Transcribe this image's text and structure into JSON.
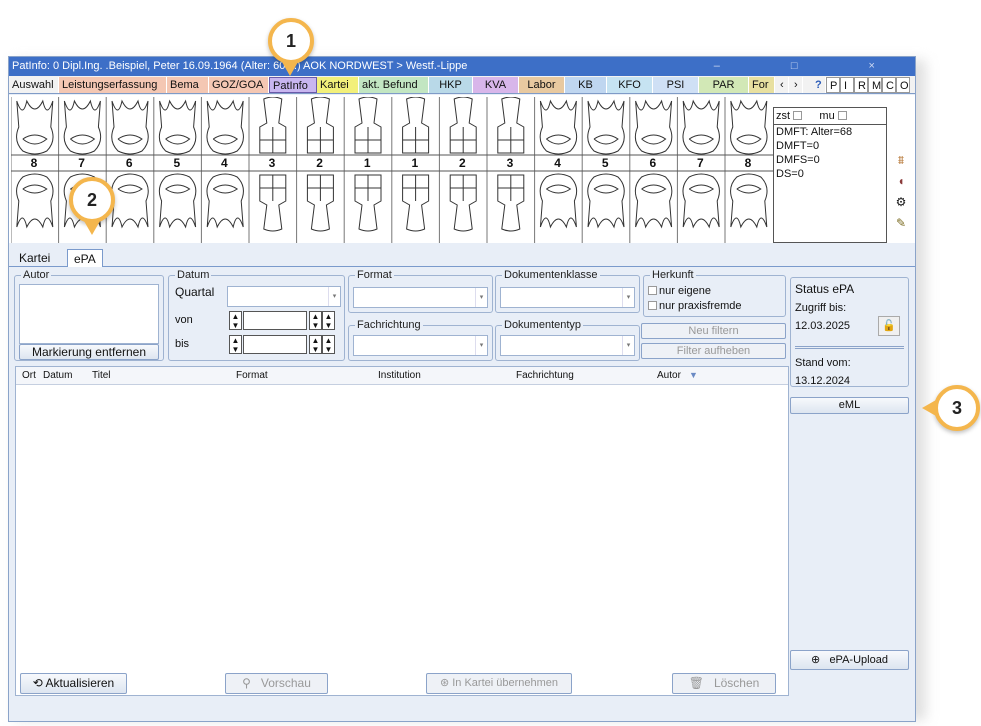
{
  "window": {
    "title": "PatInfo: 0  Dipl.Ing. .Beispiel, Peter  16.09.1964 (Alter: 60 J.)  AOK NORDWEST > Westf.-Lippe",
    "controls": "–  □  ×"
  },
  "nav_tabs": [
    {
      "label": "Auswahl",
      "color": "#f2f2f2"
    },
    {
      "label": "Leistungserfassung",
      "color": "#f4c7b3"
    },
    {
      "label": "Bema",
      "color": "#f4c7b3"
    },
    {
      "label": "GOZ/GOA",
      "color": "#f4c7b3"
    },
    {
      "label": "PatInfo",
      "color": "#c8b6f0"
    },
    {
      "label": "Kartei",
      "color": "#f2f07a"
    },
    {
      "label": "akt. Befund",
      "color": "#c2e6c2"
    },
    {
      "label": "HKP",
      "color": "#b9d9e8"
    },
    {
      "label": "KVA",
      "color": "#d8b6ea"
    },
    {
      "label": "Labor",
      "color": "#e8c9a0"
    },
    {
      "label": "KB",
      "color": "#bfd6f0"
    },
    {
      "label": "KFO",
      "color": "#c6e3f2"
    },
    {
      "label": "PSI",
      "color": "#cfe0f5"
    },
    {
      "label": "PAR",
      "color": "#d2e8b6"
    },
    {
      "label": "For",
      "color": "#e8e0a0"
    }
  ],
  "tab_arrows": [
    "‹",
    "›"
  ],
  "quick_letters": [
    "P",
    "I",
    "R",
    "M",
    "C",
    "O"
  ],
  "tooth_numbers": [
    "8",
    "7",
    "6",
    "5",
    "4",
    "3",
    "2",
    "1",
    "1",
    "2",
    "3",
    "4",
    "5",
    "6",
    "7",
    "8"
  ],
  "info_box": {
    "zst": "zst",
    "mu": "mu",
    "lines": [
      "DMFT: Alter=68",
      "DMFT=0",
      "DMFS=0",
      "DS=0"
    ]
  },
  "subtabs": {
    "kartei": "Kartei",
    "epa": "ePA"
  },
  "filters": {
    "autor": "Autor",
    "markierung": "Markierung entfernen",
    "datum": "Datum",
    "quartal": "Quartal",
    "von": "von",
    "bis": "bis",
    "format": "Format",
    "fachrichtung": "Fachrichtung",
    "dokumentenklasse": "Dokumentenklasse",
    "dokumententyp": "Dokumententyp",
    "herkunft": "Herkunft",
    "nur_eigene": "nur eigene",
    "nur_praxisfremde": "nur praxisfremde",
    "neu_filtern": "Neu filtern",
    "filter_aufheben": "Filter aufheben"
  },
  "status_epa": {
    "title": "Status ePA",
    "zugriff_label": "Zugriff bis:",
    "zugriff_date": "12.03.2025",
    "stand_label": "Stand vom:",
    "stand_date": "13.12.2024"
  },
  "columns": [
    "Ort",
    "Datum",
    "Titel",
    "Format",
    "Institution",
    "Fachrichtung",
    "Autor"
  ],
  "buttons": {
    "eml": "eML",
    "epa_upload": "ePA-Upload",
    "aktualisieren": "Aktualisieren",
    "vorschau": "Vorschau",
    "in_kartei": "In Kartei übernehmen",
    "loeschen": "Löschen"
  },
  "callouts": [
    "1",
    "2",
    "3"
  ]
}
